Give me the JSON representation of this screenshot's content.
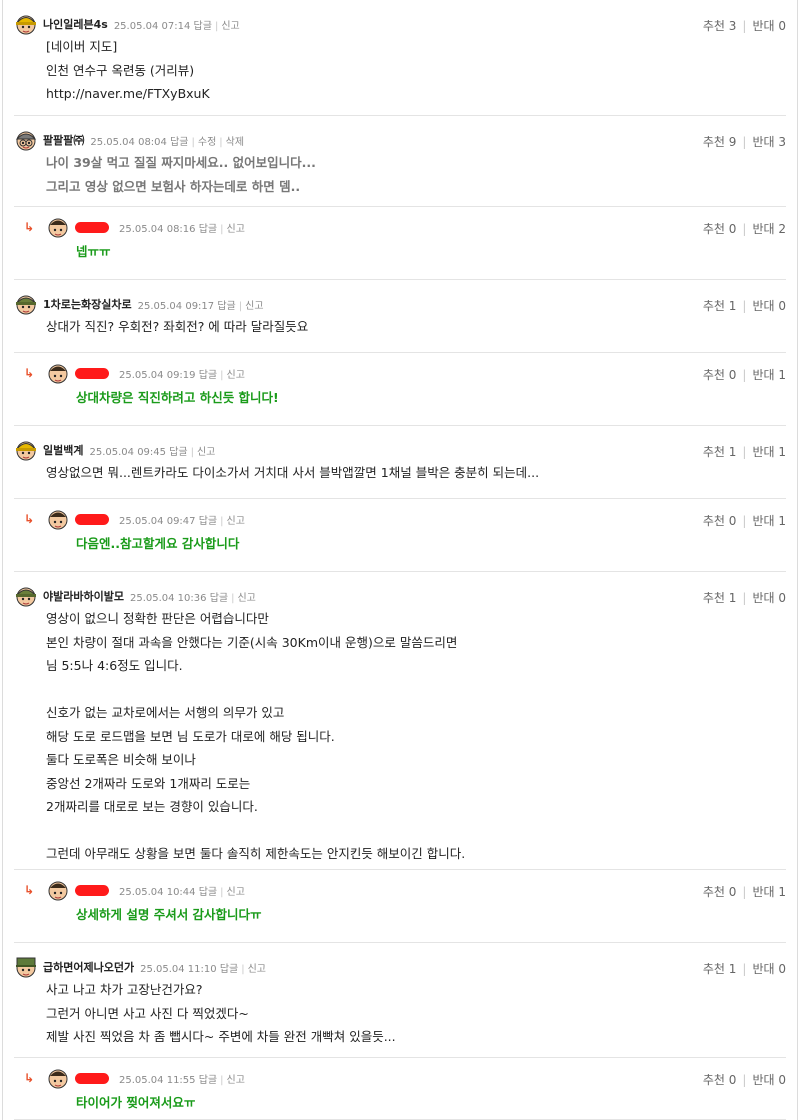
{
  "comments": [
    {
      "kind": "top",
      "avatar": "yellow",
      "nick": "나인일레븐4s",
      "time": "25.05.04 07:14",
      "actions": [
        "답글",
        "신고"
      ],
      "votes": {
        "up": "추천 3",
        "down": "반대 0"
      },
      "lines": [
        "[네이버 지도]",
        "인천 연수구 옥련동 (거리뷰)",
        "http://naver.me/FTXyBxuK"
      ]
    },
    {
      "kind": "top",
      "style": "grey",
      "avatar": "grey",
      "nick": "팔팔팔㈜",
      "time": "25.05.04 08:04",
      "actions": [
        "답글",
        "수정",
        "삭제"
      ],
      "votes": {
        "up": "추천 9",
        "down": "반대 3"
      },
      "lines": [
        "나이 39살 먹고 질질 짜지마세요.. 없어보입니다...",
        "그리고 영상 없으면 보험사 하자는데로 하면 뎀.."
      ]
    },
    {
      "kind": "reply",
      "avatar": "kid",
      "time": "25.05.04 08:16",
      "actions": [
        "답글",
        "신고"
      ],
      "votes": {
        "up": "추천 0",
        "down": "반대 2"
      },
      "lines": [
        "넵ㅠㅠ"
      ]
    },
    {
      "kind": "top",
      "avatar": "green",
      "nick": "1차로는화장실차로",
      "time": "25.05.04 09:17",
      "actions": [
        "답글",
        "신고"
      ],
      "votes": {
        "up": "추천 1",
        "down": "반대 0"
      },
      "lines": [
        "상대가 직진? 우회전? 좌회전? 에 따라 달라질듯요"
      ]
    },
    {
      "kind": "reply",
      "avatar": "kid",
      "time": "25.05.04 09:19",
      "actions": [
        "답글",
        "신고"
      ],
      "votes": {
        "up": "추천 0",
        "down": "반대 1"
      },
      "lines": [
        "상대차량은 직진하려고 하신듯 합니다!"
      ]
    },
    {
      "kind": "top",
      "avatar": "yellow",
      "nick": "일벌백계",
      "time": "25.05.04 09:45",
      "actions": [
        "답글",
        "신고"
      ],
      "votes": {
        "up": "추천 1",
        "down": "반대 1"
      },
      "lines": [
        "영상없으면 뭐...렌트카라도 다이소가서 거치대 사서 블박앱깔면 1채널 블박은 충분히 되는데..."
      ]
    },
    {
      "kind": "reply",
      "avatar": "kid",
      "time": "25.05.04 09:47",
      "actions": [
        "답글",
        "신고"
      ],
      "votes": {
        "up": "추천 0",
        "down": "반대 1"
      },
      "lines": [
        "다음엔..참고할게요 감사합니다"
      ]
    },
    {
      "kind": "top",
      "avatar": "green",
      "nick": "야발라바하이발모",
      "time": "25.05.04 10:36",
      "actions": [
        "답글",
        "신고"
      ],
      "votes": {
        "up": "추천 1",
        "down": "반대 0"
      },
      "lines": [
        "영상이 없으니 정확한 판단은 어렵습니다만",
        "본인 차량이 절대 과속을 안했다는 기준(시속 30Km이내 운행)으로 말씀드리면",
        "님 5:5나 4:6정도 입니다.",
        "",
        "신호가 없는 교차로에서는 서행의 의무가 있고",
        "해당 도로 로드맵을 보면 님 도로가 대로에 해당 됩니다.",
        "둘다 도로폭은 비슷해 보이나",
        "중앙선 2개짜라 도로와 1개짜리 도로는",
        "2개짜리를 대로로 보는 경향이 있습니다.",
        "",
        "그런데 아무래도 상황을 보면 둘다 솔직히 제한속도는 안지킨듯 해보이긴 합니다."
      ]
    },
    {
      "kind": "reply",
      "avatar": "kid",
      "time": "25.05.04 10:44",
      "actions": [
        "답글",
        "신고"
      ],
      "votes": {
        "up": "추천 0",
        "down": "반대 1"
      },
      "lines": [
        "상세하게 설명 주셔서 감사합니다ㅠ"
      ]
    },
    {
      "kind": "top",
      "avatar": "soldier",
      "nick": "급하면어제나오던가",
      "time": "25.05.04 11:10",
      "actions": [
        "답글",
        "신고"
      ],
      "votes": {
        "up": "추천 1",
        "down": "반대 0"
      },
      "lines": [
        "사고 나고 차가 고장난건가요?",
        "그런거 아니면 사고 사진 다 찍었겠다~",
        "제발 사진 찍었음 차 좀 뺍시다~ 주변에 차들 완전 개빡쳐 있을듯..."
      ]
    },
    {
      "kind": "reply",
      "avatar": "kid",
      "time": "25.05.04 11:55",
      "actions": [
        "답글",
        "신고"
      ],
      "votes": {
        "up": "추천 0",
        "down": "반대 0"
      },
      "lines": [
        "타이어가 찢어져서요ㅠ"
      ]
    }
  ],
  "colors": {
    "accent_reply": "#1a9b1a",
    "redaction": "#ff1a1a",
    "arrow": "#e8522d"
  }
}
